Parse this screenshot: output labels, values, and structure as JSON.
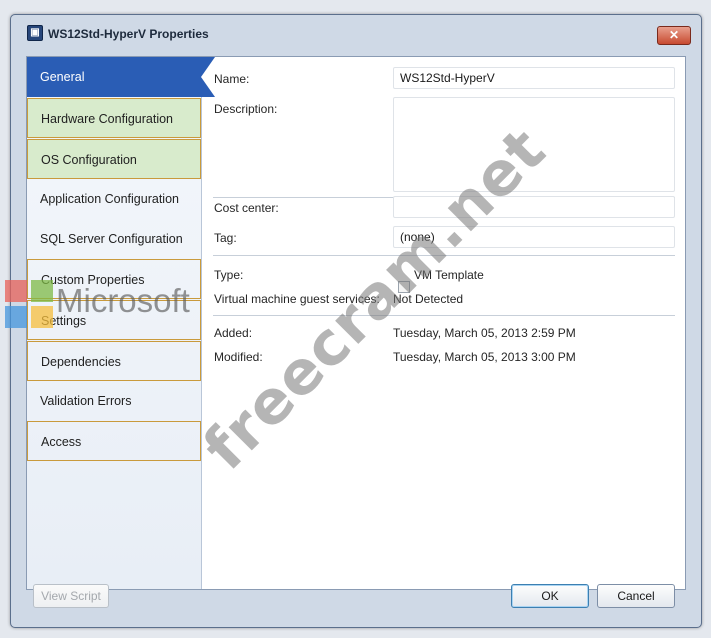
{
  "window": {
    "title": "WS12Std-HyperV Properties",
    "icon": "vm-properties-icon",
    "close_glyph": "✕"
  },
  "nav": {
    "items": [
      {
        "label": "General",
        "selected": true
      },
      {
        "label": "Hardware Configuration"
      },
      {
        "label": "OS Configuration"
      },
      {
        "label": "Application Configuration"
      },
      {
        "label": "SQL Server Configuration"
      },
      {
        "label": "Custom Properties"
      },
      {
        "label": "Settings"
      },
      {
        "label": "Dependencies"
      },
      {
        "label": "Validation Errors"
      },
      {
        "label": "Access"
      }
    ]
  },
  "general": {
    "name_label": "Name:",
    "name_value": "WS12Std-HyperV",
    "description_label": "Description:",
    "description_value": "",
    "cost_center_label": "Cost center:",
    "cost_center_value": "",
    "tag_label": "Tag:",
    "tag_value": "(none)",
    "type_label": "Type:",
    "type_value": "VM Template",
    "guest_services_label": "Virtual machine guest services:",
    "guest_services_value": "Not Detected",
    "added_label": "Added:",
    "added_value": "Tuesday, March 05, 2013 2:59 PM",
    "modified_label": "Modified:",
    "modified_value": "Tuesday, March 05, 2013 3:00 PM"
  },
  "footer": {
    "view_script": "View Script",
    "ok": "OK",
    "cancel": "Cancel"
  },
  "overlays": {
    "watermark": "freecram.net",
    "logo_text": "Microsoft"
  },
  "colors": {
    "accent": "#2a5db5",
    "highlight_fill": "#d8ebcc",
    "highlight_border": "#c99a3c"
  }
}
